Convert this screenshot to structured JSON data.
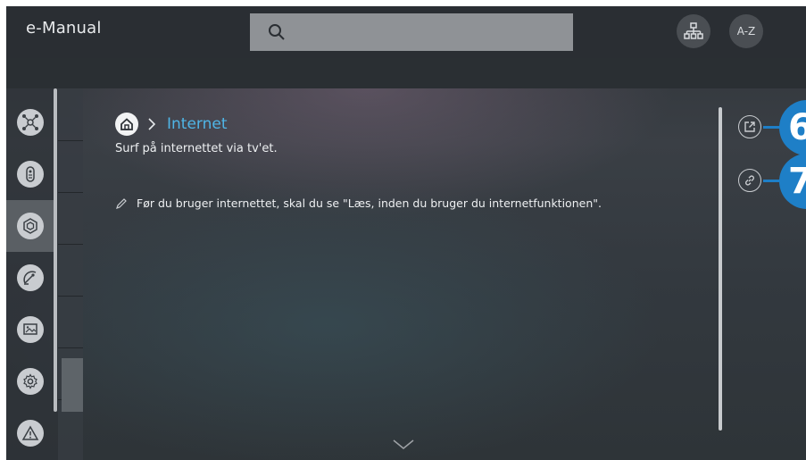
{
  "app": {
    "title": "e-Manual"
  },
  "header": {
    "search_icon": "search-icon",
    "tree_icon": "sitemap-icon",
    "az_label": "A-Z"
  },
  "sidebar": {
    "items": [
      {
        "icon": "connections-icon",
        "active": false
      },
      {
        "icon": "remote-icon",
        "active": false
      },
      {
        "icon": "smart-features-icon",
        "active": true
      },
      {
        "icon": "satellite-dish-icon",
        "active": false
      },
      {
        "icon": "picture-icon",
        "active": false
      },
      {
        "icon": "settings-gear-icon",
        "active": false
      },
      {
        "icon": "warning-icon",
        "active": false
      }
    ]
  },
  "content": {
    "breadcrumb_title": "Internet",
    "subtitle": "Surf på internettet via tv'et.",
    "note": "Før du bruger internettet, skal du se \"Læs, inden du bruger du internetfunktionen\"."
  },
  "actions": {
    "external_icon": "external-link-icon",
    "link_icon": "link-icon"
  },
  "callouts": {
    "first": "6",
    "second": "7"
  },
  "colors": {
    "accent": "#4fb5e6",
    "callout": "#1e7fc7"
  }
}
